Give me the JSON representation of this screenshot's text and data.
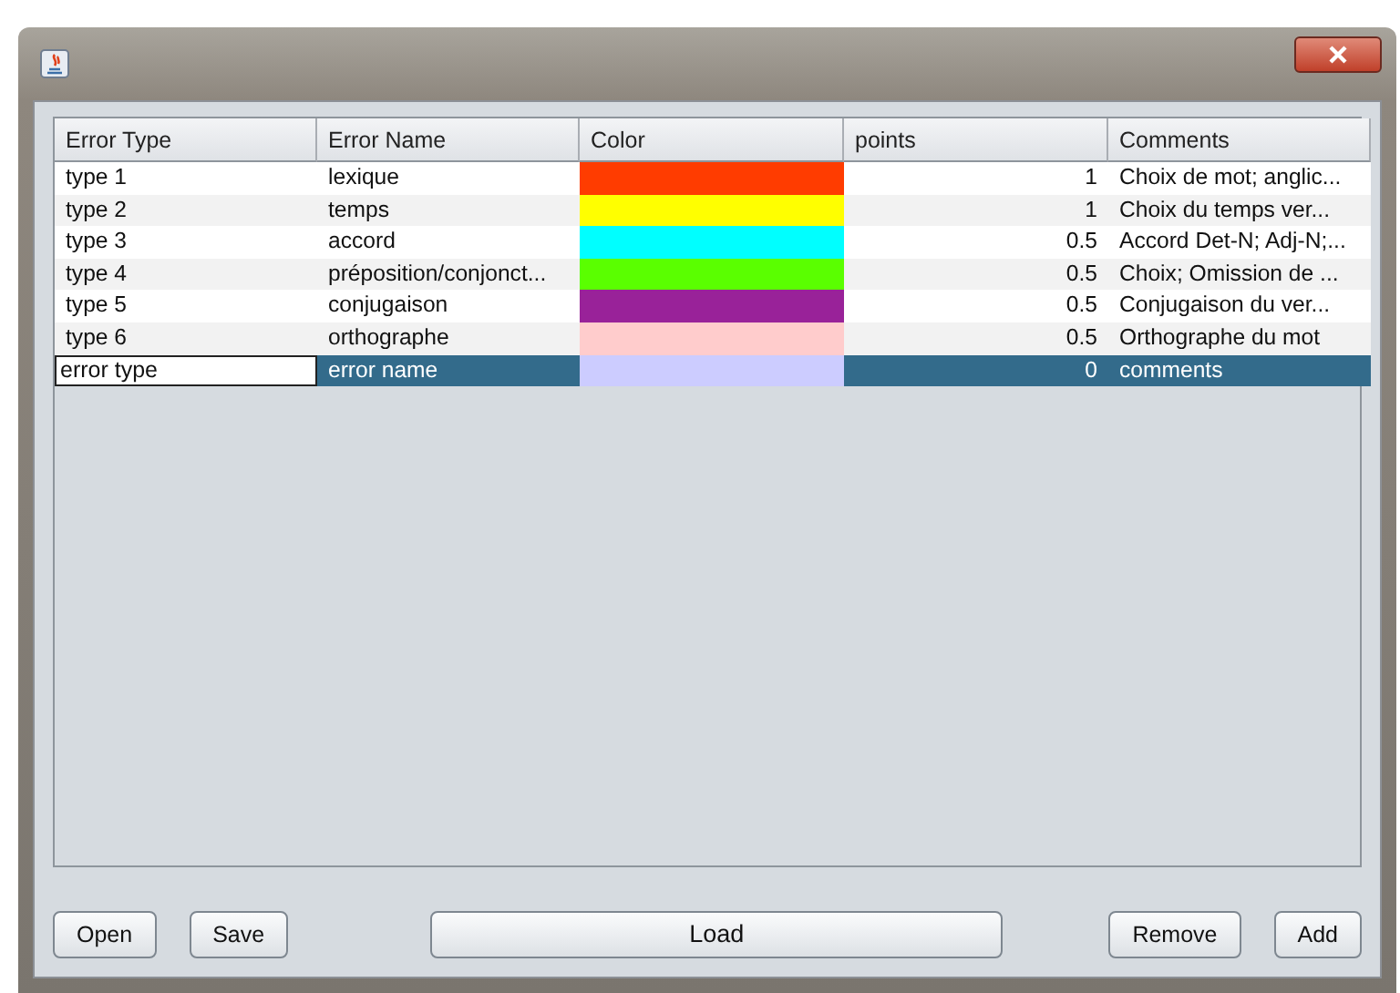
{
  "table": {
    "columns": [
      "Error Type",
      "Error Name",
      "Color",
      "points",
      "Comments"
    ],
    "rows": [
      {
        "error_type": "type 1",
        "error_name": "lexique",
        "color": "#ff3c00",
        "points": "1",
        "comments": "Choix de mot; anglic...",
        "selected": false,
        "editing": false
      },
      {
        "error_type": "type 2",
        "error_name": "temps",
        "color": "#ffff00",
        "points": "1",
        "comments": "Choix du temps ver...",
        "selected": false,
        "editing": false
      },
      {
        "error_type": "type 3",
        "error_name": "accord",
        "color": "#00ffff",
        "points": "0.5",
        "comments": "Accord Det-N; Adj-N;...",
        "selected": false,
        "editing": false
      },
      {
        "error_type": "type 4",
        "error_name": "préposition/conjonct...",
        "color": "#5aff00",
        "points": "0.5",
        "comments": "Choix; Omission de ...",
        "selected": false,
        "editing": false
      },
      {
        "error_type": "type 5",
        "error_name": "conjugaison",
        "color": "#992299",
        "points": "0.5",
        "comments": "Conjugaison du ver...",
        "selected": false,
        "editing": false
      },
      {
        "error_type": "type 6",
        "error_name": "orthographe",
        "color": "#ffcccc",
        "points": "0.5",
        "comments": "Orthographe du mot",
        "selected": false,
        "editing": false
      },
      {
        "error_type": "error type",
        "error_name": "error name",
        "color": "#ccccff",
        "points": "0",
        "comments": "comments",
        "selected": true,
        "editing": true
      }
    ]
  },
  "buttons": [
    {
      "label": "Open",
      "kind": "small"
    },
    {
      "label": "Save",
      "kind": "small"
    },
    {
      "label": "Load",
      "kind": "wide"
    },
    {
      "label": "Remove",
      "kind": "small"
    },
    {
      "label": "Add",
      "kind": "small"
    }
  ]
}
